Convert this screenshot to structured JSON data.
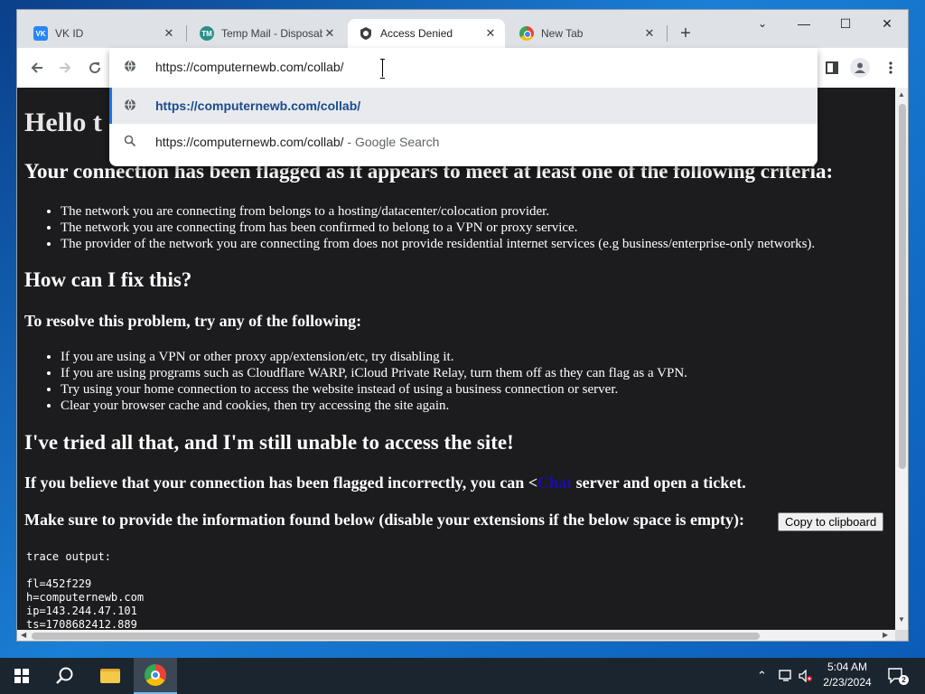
{
  "browser": {
    "tabs": [
      {
        "title": "VK ID",
        "icon": "vk-icon",
        "active": false
      },
      {
        "title": "Temp Mail - Disposab",
        "icon": "temp-mail-icon",
        "active": false
      },
      {
        "title": "Access Denied",
        "icon": "access-denied-icon",
        "active": true
      },
      {
        "title": "New Tab",
        "icon": "chrome-icon",
        "active": false
      }
    ],
    "window_controls": {
      "minimize": "—",
      "maximize": "☐",
      "close": "✕"
    },
    "omnibox": {
      "value": "https://computernewb.com/collab/",
      "suggestions": [
        {
          "text": "https://computernewb.com/collab/",
          "suffix": "",
          "icon": "globe-icon"
        },
        {
          "text": "https://computernewb.com/collab/",
          "suffix": " - Google Search",
          "icon": "search-icon"
        }
      ]
    }
  },
  "page": {
    "title": "Hello t",
    "flag_heading": "Your connection has been flagged as it appears to meet at least one of the following criteria:",
    "criteria": [
      "The network you are connecting from belongs to a hosting/datacenter/colocation provider.",
      "The network you are connecting from has been confirmed to belong to a VPN or proxy service.",
      "The provider of the network you are connecting from does not provide residential internet services (e.g business/enterprise-only networks)."
    ],
    "fix_heading": "How can I fix this?",
    "resolve_heading": "To resolve this problem, try any of the following:",
    "fixes": [
      "If you are using a VPN or other proxy app/extension/etc, try disabling it.",
      "If you are using programs such as Cloudflare WARP, iCloud Private Relay, turn them off as they can flag as a VPN.",
      "Try using your home connection to access the website instead of using a business connection or server.",
      "Clear your browser cache and cookies, then try accessing the site again."
    ],
    "tried_heading": "I've tried all that, and I'm still unable to access the site!",
    "incorrect_prefix": "If you believe that your connection has been flagged incorrectly, you can <",
    "incorrect_link": "Chat",
    "incorrect_suffix": " server and open a ticket.",
    "provide_heading": "Make sure to provide the information found below (disable your extensions if the below space is empty):",
    "copy_button": "Copy to clipboard",
    "trace_output": "trace output:\n\nfl=452f229\nh=computernewb.com\nip=143.244.47.101\nts=1708682412.889"
  },
  "taskbar": {
    "time": "5:04 AM",
    "date": "2/23/2024",
    "notification_count": "2"
  }
}
